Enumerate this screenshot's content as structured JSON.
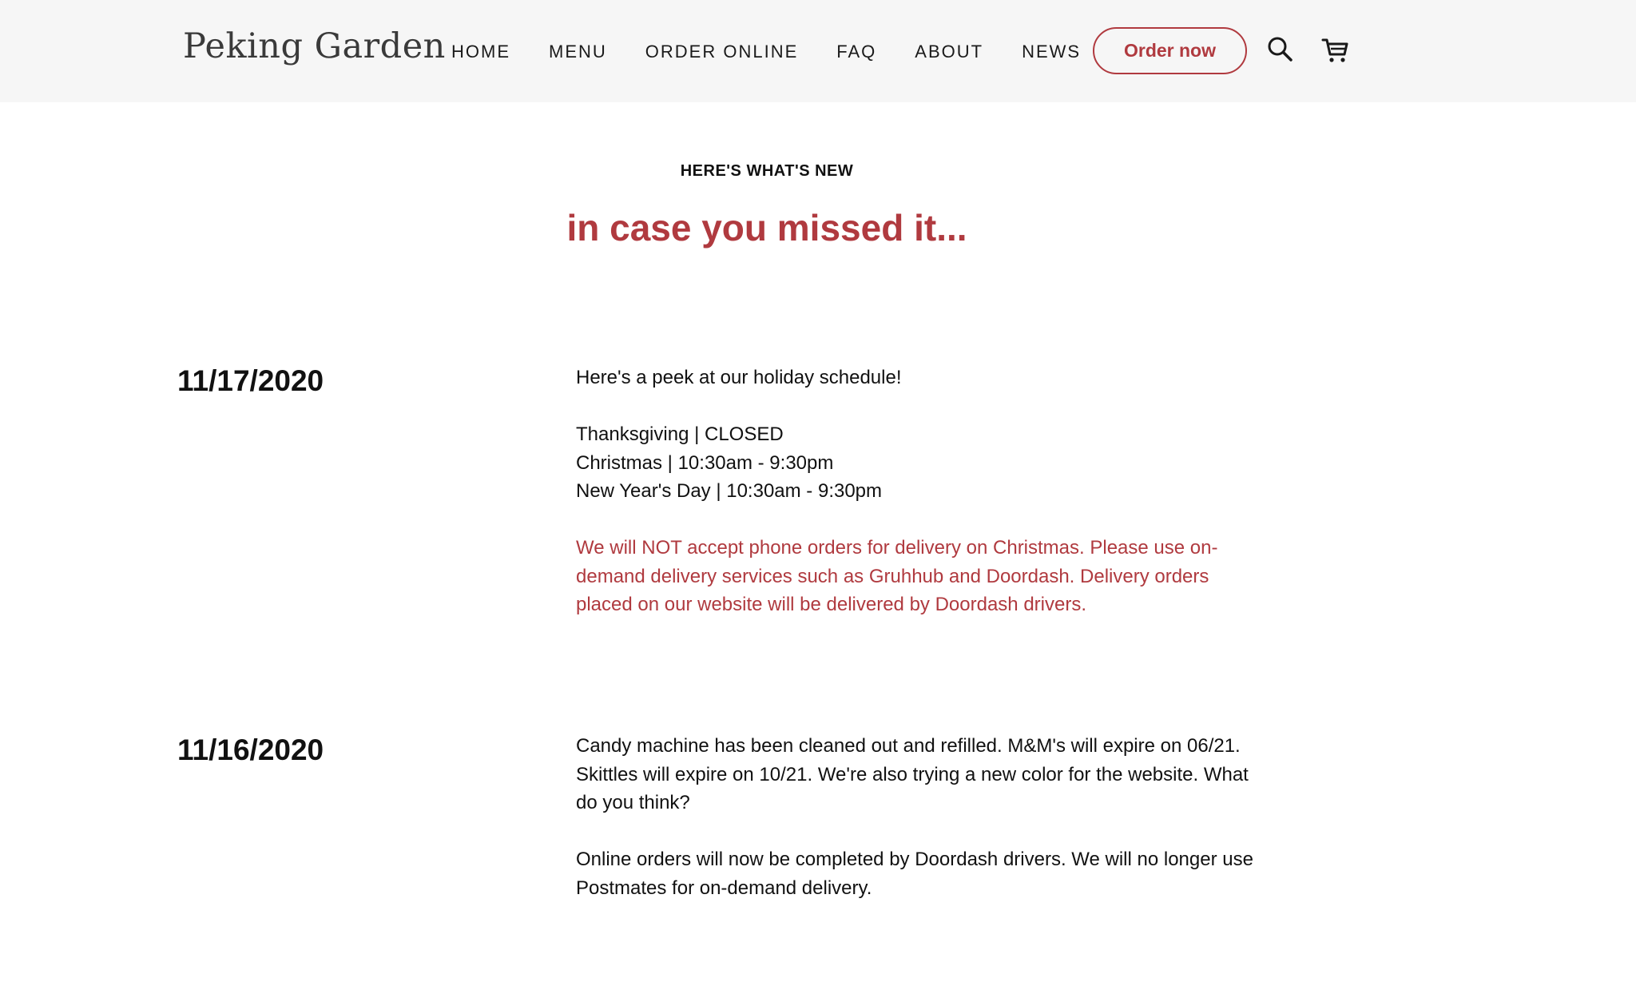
{
  "header": {
    "logo": "Peking Garden",
    "nav": [
      "HOME",
      "MENU",
      "ORDER ONLINE",
      "FAQ",
      "ABOUT",
      "NEWS"
    ],
    "order_button": "Order now",
    "icons": [
      "search-icon",
      "cart-icon"
    ],
    "accent_color": "#b03a3f"
  },
  "section": {
    "eyebrow": "HERE'S WHAT'S NEW",
    "title": "in case you missed it..."
  },
  "posts": [
    {
      "date": "11/17/2020",
      "intro": "Here's a peek at our holiday schedule!",
      "schedule": [
        "Thanksgiving | CLOSED",
        "Christmas | 10:30am - 9:30pm",
        "New Year's Day | 10:30am - 9:30pm"
      ],
      "notice": "We will NOT accept phone orders for delivery on Christmas. Please use on-demand delivery services such as Gruhhub and Doordash. Delivery orders placed on our website will be delivered by Doordash drivers."
    },
    {
      "date": "11/16/2020",
      "paragraph1": "Candy machine has been cleaned out and refilled. M&M's will expire on 06/21. Skittles will expire on 10/21. We're also trying a new color for the website. What do you think?",
      "paragraph2": "Online orders will now be completed by Doordash drivers. We will no longer use Postmates for on-demand delivery."
    }
  ]
}
